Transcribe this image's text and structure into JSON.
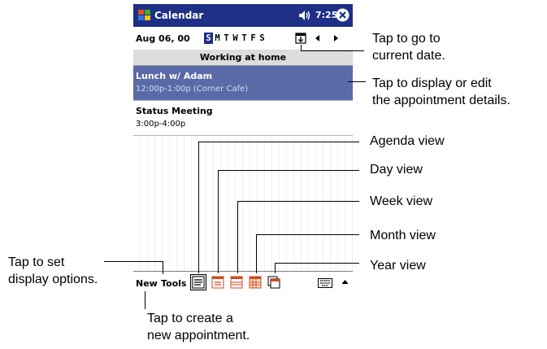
{
  "app": {
    "title": "Calendar",
    "clock": "7:25",
    "icons": {
      "start": "windows-flag-icon",
      "speaker": "speaker-icon",
      "close": "close-icon"
    }
  },
  "nav": {
    "date": "Aug 06, 00",
    "weekdays": [
      "S",
      "M",
      "T",
      "W",
      "T",
      "F",
      "S"
    ],
    "selected_day_index": 0,
    "icons": {
      "today": "go-to-today-icon",
      "prev": "previous-arrow-icon",
      "next": "next-arrow-icon"
    }
  },
  "banner": "Working at home",
  "appointments": [
    {
      "title": "Lunch w/ Adam",
      "time": "12:00p-1:00p (Corner Cafe)"
    },
    {
      "title": "Status Meeting",
      "time": "3:00p-4:00p"
    }
  ],
  "toolbar": {
    "menu_new": "New",
    "menu_tools": "Tools",
    "views": [
      "agenda-view-icon",
      "day-view-icon",
      "week-view-icon",
      "month-view-icon",
      "year-view-icon"
    ],
    "active_view": "agenda-view-icon",
    "keyboard": "keyboard-icon",
    "sip": "input-panel-arrow-icon"
  },
  "callouts": {
    "current_date": [
      "Tap to go to",
      "current date."
    ],
    "appointment": [
      "Tap to display or edit",
      "the appointment details."
    ],
    "agenda": "Agenda view",
    "day": "Day view",
    "week": "Week view",
    "month": "Month view",
    "year": "Year view",
    "options": [
      "Tap to set",
      "display options."
    ],
    "new": [
      "Tap to create a",
      "new appointment."
    ]
  },
  "colors": {
    "titlebar": "#1e2f86",
    "selected_appointment": "#5a6aa8",
    "banner": "#dcdcdc"
  }
}
